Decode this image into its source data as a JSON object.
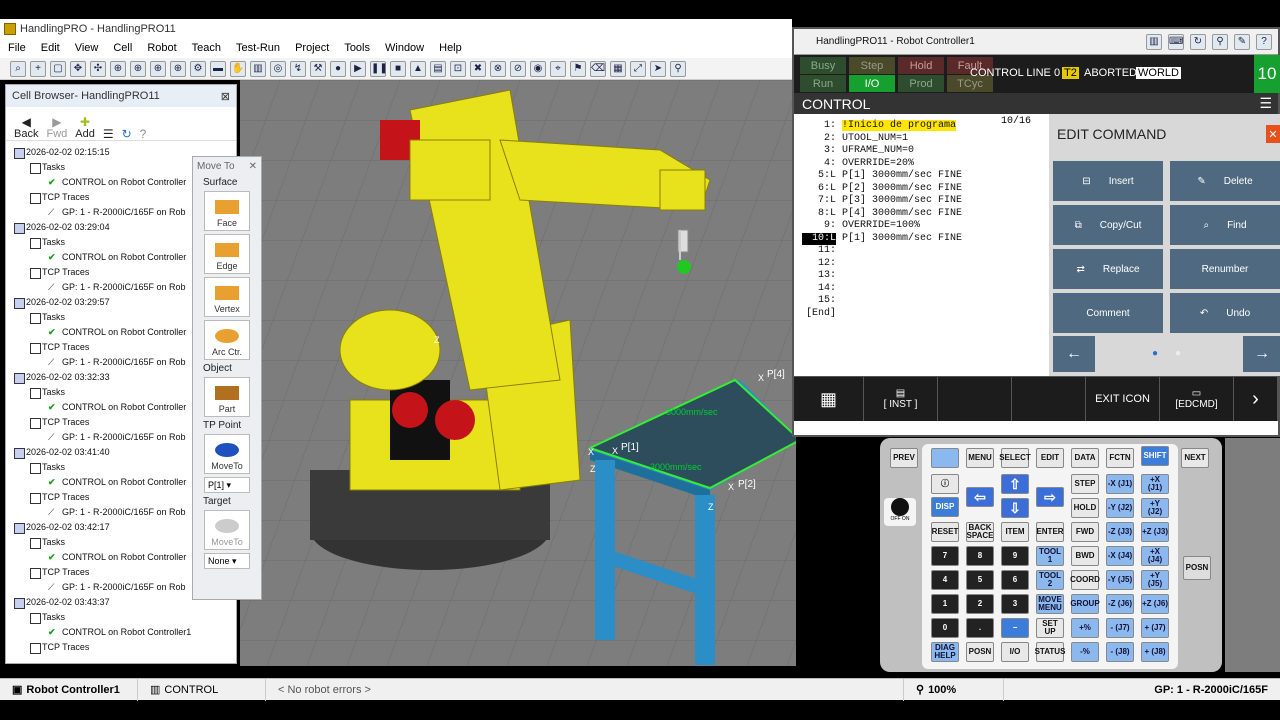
{
  "window": {
    "title": "HandlingPRO - HandlingPRO11"
  },
  "menu": [
    "File",
    "Edit",
    "View",
    "Cell",
    "Robot",
    "Teach",
    "Test-Run",
    "Project",
    "Tools",
    "Window",
    "Help"
  ],
  "cell_browser": {
    "title": "Cell Browser- HandlingPRO11",
    "back": "Back",
    "fwd": "Fwd",
    "add": "Add",
    "entries": [
      {
        "date": "2026-02-02 02:15:15",
        "tasks": "Tasks",
        "task": "CONTROL on Robot Controller",
        "traces": "TCP Traces",
        "gp": "GP: 1 - R-2000iC/165F on Rob"
      },
      {
        "date": "2026-02-02 03:29:04",
        "tasks": "Tasks",
        "task": "CONTROL on Robot Controller",
        "traces": "TCP Traces",
        "gp": "GP: 1 - R-2000iC/165F on Rob"
      },
      {
        "date": "2026-02-02 03:29:57",
        "tasks": "Tasks",
        "task": "CONTROL on Robot Controller",
        "traces": "TCP Traces",
        "gp": "GP: 1 - R-2000iC/165F on Rob"
      },
      {
        "date": "2026-02-02 03:32:33",
        "tasks": "Tasks",
        "task": "CONTROL on Robot Controller",
        "traces": "TCP Traces",
        "gp": "GP: 1 - R-2000iC/165F on Rob"
      },
      {
        "date": "2026-02-02 03:41:40",
        "tasks": "Tasks",
        "task": "CONTROL on Robot Controller",
        "traces": "TCP Traces",
        "gp": "GP: 1 - R-2000iC/165F on Rob"
      },
      {
        "date": "2026-02-02 03:42:17",
        "tasks": "Tasks",
        "task": "CONTROL on Robot Controller",
        "traces": "TCP Traces",
        "gp": "GP: 1 - R-2000iC/165F on Rob"
      },
      {
        "date": "2026-02-02 03:43:37",
        "tasks": "Tasks",
        "task": "CONTROL on Robot Controller1",
        "traces": "TCP Traces",
        "gp": ""
      }
    ]
  },
  "move_to": {
    "title": "Move To",
    "surface": "Surface",
    "face": "Face",
    "edge": "Edge",
    "vertex": "Vertex",
    "arc": "Arc Ctr.",
    "object": "Object",
    "part": "Part",
    "tp_point": "TP Point",
    "moveto": "MoveTo",
    "point_sel": "P[1]",
    "target": "Target",
    "moveto2": "MoveTo",
    "target_sel": "None"
  },
  "viewport": {
    "labels": {
      "p1": "P[1]",
      "p2": "P[2]",
      "p4": "P[4]",
      "speed1": "3000mm/sec",
      "speed2": "3000mm/sec",
      "z1": "Z",
      "z2": "Z",
      "z3": "Z",
      "x1": "X",
      "x2": "X",
      "x3": "X",
      "x4": "X"
    }
  },
  "teach_pendant": {
    "title": "HandlingPRO11 - Robot Controller1",
    "leds": [
      "Busy",
      "Step",
      "Hold",
      "Fault",
      "Run",
      "I/O",
      "Prod",
      "TCyc"
    ],
    "status_text": "CONTROL LINE 0",
    "t2": "T2",
    "aborted": "ABORTED",
    "world": "WORLD",
    "override": "10",
    "screen": "CONTROL",
    "line_count": "10/16",
    "program": [
      {
        "n": "1:",
        "t": "!Inicio de programa",
        "hl": true
      },
      {
        "n": "2:",
        "t": "UTOOL_NUM=1"
      },
      {
        "n": "3:",
        "t": "UFRAME_NUM=0"
      },
      {
        "n": "4:",
        "t": "OVERRIDE=20%"
      },
      {
        "n": "5:L",
        "t": "P[1] 3000mm/sec FINE"
      },
      {
        "n": "6:L",
        "t": "P[2] 3000mm/sec FINE"
      },
      {
        "n": "7:L",
        "t": "P[3] 3000mm/sec FINE"
      },
      {
        "n": "8:L",
        "t": "P[4] 3000mm/sec FINE"
      },
      {
        "n": "9:",
        "t": "OVERRIDE=100%"
      },
      {
        "n": "10:L",
        "t": "P[1] 3000mm/sec FINE",
        "cur": true
      },
      {
        "n": "11:",
        "t": ""
      },
      {
        "n": "12:",
        "t": ""
      },
      {
        "n": "13:",
        "t": ""
      },
      {
        "n": "14:",
        "t": ""
      },
      {
        "n": "15:",
        "t": ""
      },
      {
        "n": "[End]",
        "t": ""
      }
    ],
    "edit_command": {
      "title": "EDIT COMMAND",
      "buttons": [
        "Insert",
        "Delete",
        "Copy/Cut",
        "Find",
        "Replace",
        "Renumber",
        "Comment",
        "Undo"
      ]
    },
    "func_keys": {
      "inst": "[ INST ]",
      "exit": "EXIT ICON",
      "edcmd": "[EDCMD]"
    }
  },
  "keypad": {
    "prev": "PREV",
    "menu": "MENU",
    "select": "SELECT",
    "edit": "EDIT",
    "data": "DATA",
    "fctn": "FCTN",
    "shift": "SHIFT",
    "next": "NEXT",
    "disp": "DISP",
    "step": "STEP",
    "hold": "HOLD",
    "reset": "RESET",
    "backspace": "BACK SPACE",
    "item": "ITEM",
    "enter": "ENTER",
    "fwd": "FWD",
    "bwd": "BWD",
    "tool1": "TOOL 1",
    "tool2": "TOOL 2",
    "coord": "COORD",
    "movemenu": "MOVE MENU",
    "group": "GROUP",
    "setup": "SET UP",
    "diag": "DIAG HELP",
    "posn": "POSN",
    "io": "I/O",
    "status": "STATUS",
    "posn2": "POSN",
    "nums": [
      "7",
      "8",
      "9",
      "4",
      "5",
      "6",
      "1",
      "2",
      "3",
      "0",
      "."
    ],
    "jog": [
      "-X (J1)",
      "+X (J1)",
      "-Y (J2)",
      "+Y (J2)",
      "-Z (J3)",
      "+Z (J3)",
      "-X (J4)",
      "+X (J4)",
      "-Y (J5)",
      "+Y (J5)",
      "-Z (J6)",
      "+Z (J6)",
      "- (J7)",
      "+ (J7)",
      "- (J8)",
      "+ (J8)"
    ],
    "offon": "OFF ON"
  },
  "status_bar": {
    "controller": "Robot Controller1",
    "program": "CONTROL",
    "errors": "< No robot errors >",
    "zoom": "100%",
    "gp": "GP: 1 - R-2000iC/165F"
  }
}
